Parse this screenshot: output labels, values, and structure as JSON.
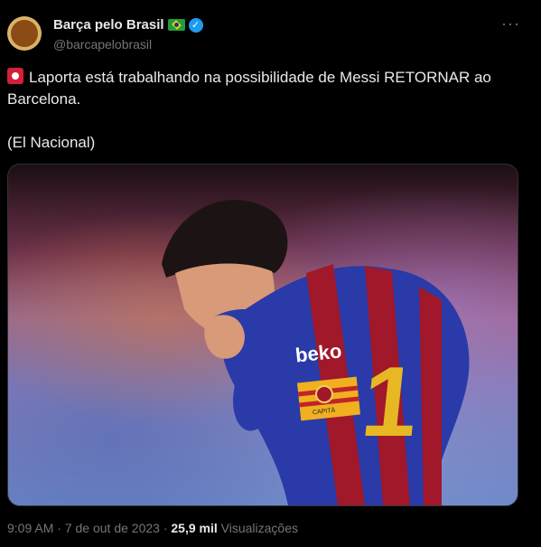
{
  "account": {
    "display_name": "Barça pelo Brasil",
    "handle": "@barcapelobrasil",
    "verified_icon": "check-badge-icon",
    "flag_icon": "brazil-flag-icon"
  },
  "menu": {
    "more_label": "···"
  },
  "tweet": {
    "line1": "Laporta está trabalhando na possibilidade de Messi RETORNAR ao Barcelona.",
    "line2": "(El Nacional)",
    "emoji": "siren-icon"
  },
  "media": {
    "sponsor": "beko",
    "armband": "CAPITÀ"
  },
  "footer": {
    "time": "9:09 AM",
    "separator": "·",
    "date": "7 de out de 2023",
    "views_count": "25,9 mil",
    "views_label": "Visualizações"
  },
  "colors": {
    "background": "#000000",
    "text": "#e7e9ea",
    "muted": "#71767b",
    "verified": "#1d9bf0"
  }
}
